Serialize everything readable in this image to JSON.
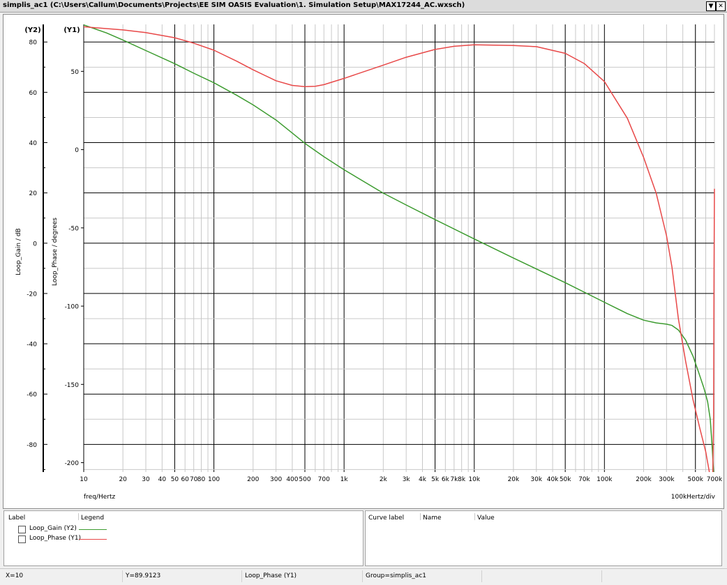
{
  "window": {
    "title": "simplis_ac1 (C:\\Users\\Callum\\Documents\\Projects\\EE SIM OASIS Evaluation\\1. Simulation Setup\\MAX17244_AC.wxsch)",
    "dropdown_glyph": "▼",
    "close_glyph": "✕"
  },
  "chart_data": {
    "type": "line",
    "x_scale": "log",
    "xlim": [
      10,
      700000
    ],
    "xlabel": "freq/Hertz",
    "x_div_label": "100kHertz/div",
    "x_ticks": [
      {
        "v": 10,
        "label": "10"
      },
      {
        "v": 20,
        "label": "20"
      },
      {
        "v": 30,
        "label": "30"
      },
      {
        "v": 40,
        "label": "40"
      },
      {
        "v": 50,
        "label": "50"
      },
      {
        "v": 60,
        "label": "60"
      },
      {
        "v": 70,
        "label": "70"
      },
      {
        "v": 80,
        "label": "80"
      },
      {
        "v": 100,
        "label": "100"
      },
      {
        "v": 200,
        "label": "200"
      },
      {
        "v": 300,
        "label": "300"
      },
      {
        "v": 400,
        "label": "400"
      },
      {
        "v": 500,
        "label": "500"
      },
      {
        "v": 700,
        "label": "700"
      },
      {
        "v": 1000,
        "label": "1k"
      },
      {
        "v": 2000,
        "label": "2k"
      },
      {
        "v": 3000,
        "label": "3k"
      },
      {
        "v": 4000,
        "label": "4k"
      },
      {
        "v": 5000,
        "label": "5k"
      },
      {
        "v": 6000,
        "label": "6k"
      },
      {
        "v": 7000,
        "label": "7k"
      },
      {
        "v": 8000,
        "label": "8k"
      },
      {
        "v": 10000,
        "label": "10k"
      },
      {
        "v": 20000,
        "label": "20k"
      },
      {
        "v": 30000,
        "label": "30k"
      },
      {
        "v": 40000,
        "label": "40k"
      },
      {
        "v": 50000,
        "label": "50k"
      },
      {
        "v": 70000,
        "label": "70k"
      },
      {
        "v": 100000,
        "label": "100k"
      },
      {
        "v": 200000,
        "label": "200k"
      },
      {
        "v": 300000,
        "label": "300k"
      },
      {
        "v": 500000,
        "label": "500k"
      },
      {
        "v": 700000,
        "label": "700k"
      }
    ],
    "y2_axis": {
      "tag": "(Y2)",
      "label": "Loop_Gain / dB",
      "ylim": [
        -91,
        87
      ],
      "ticks": [
        80,
        60,
        40,
        20,
        0,
        -20,
        -40,
        -60,
        -80
      ]
    },
    "y1_axis": {
      "tag": "(Y1)",
      "label": "Loop_Phase / degrees",
      "ylim": [
        -206,
        80
      ],
      "ticks": [
        50,
        0,
        -50,
        -100,
        -150,
        -200
      ]
    },
    "series": [
      {
        "name": "Loop_Gain",
        "legend": "Loop_Gain (Y2)",
        "axis": "y2",
        "color": "#3c9b2f",
        "points": [
          [
            10,
            86.8
          ],
          [
            15,
            83.6
          ],
          [
            20,
            80.8
          ],
          [
            30,
            76.6
          ],
          [
            50,
            71.4
          ],
          [
            70,
            67.6
          ],
          [
            100,
            63.8
          ],
          [
            150,
            58.8
          ],
          [
            200,
            55
          ],
          [
            300,
            49
          ],
          [
            400,
            43.8
          ],
          [
            500,
            39.7
          ],
          [
            700,
            34.4
          ],
          [
            1000,
            29.2
          ],
          [
            2000,
            19.9
          ],
          [
            3000,
            15.2
          ],
          [
            5000,
            9.4
          ],
          [
            10000,
            1.7
          ],
          [
            20000,
            -5.9
          ],
          [
            50000,
            -15.7
          ],
          [
            100000,
            -23.5
          ],
          [
            150000,
            -28
          ],
          [
            200000,
            -30.6
          ],
          [
            250000,
            -31.7
          ],
          [
            300000,
            -32.2
          ],
          [
            330000,
            -32.7
          ],
          [
            370000,
            -34.5
          ],
          [
            420000,
            -38.5
          ],
          [
            480000,
            -45
          ],
          [
            530000,
            -51.5
          ],
          [
            580000,
            -57.5
          ],
          [
            620000,
            -63
          ],
          [
            650000,
            -70
          ],
          [
            670000,
            -80
          ],
          [
            690000,
            -91
          ]
        ]
      },
      {
        "name": "Loop_Phase",
        "legend": "Loop_Phase (Y1)",
        "axis": "y1",
        "color": "#e84848",
        "points": [
          [
            10,
            78.5
          ],
          [
            20,
            76.5
          ],
          [
            30,
            74.8
          ],
          [
            50,
            71.5
          ],
          [
            70,
            68
          ],
          [
            100,
            63.5
          ],
          [
            150,
            56.5
          ],
          [
            200,
            51
          ],
          [
            300,
            44
          ],
          [
            400,
            41
          ],
          [
            500,
            40.2
          ],
          [
            600,
            40.5
          ],
          [
            700,
            41.5
          ],
          [
            1000,
            45.5
          ],
          [
            2000,
            54
          ],
          [
            3000,
            59
          ],
          [
            5000,
            64
          ],
          [
            7000,
            66
          ],
          [
            10000,
            67
          ],
          [
            20000,
            66.5
          ],
          [
            30000,
            65.8
          ],
          [
            50000,
            61.5
          ],
          [
            70000,
            55
          ],
          [
            100000,
            43.5
          ],
          [
            150000,
            20
          ],
          [
            200000,
            -5
          ],
          [
            250000,
            -28
          ],
          [
            300000,
            -55
          ],
          [
            330000,
            -75
          ],
          [
            370000,
            -108
          ],
          [
            420000,
            -135
          ],
          [
            480000,
            -160
          ],
          [
            540000,
            -178
          ],
          [
            600000,
            -193
          ],
          [
            640000,
            -206
          ]
        ]
      },
      {
        "name": "Loop_Phase_wrap",
        "axis": "y1",
        "color": "#e84848",
        "points": [
          [
            680000,
            -206
          ],
          [
            690000,
            -170
          ],
          [
            695000,
            -80
          ],
          [
            700000,
            -25
          ]
        ]
      }
    ]
  },
  "legend_panel": {
    "col_label": "Label",
    "col_legend": "Legend",
    "items": [
      {
        "name": "Loop_Gain (Y2)",
        "color": "#3c9b2f"
      },
      {
        "name": "Loop_Phase (Y1)",
        "color": "#e84848"
      }
    ]
  },
  "values_panel": {
    "col_curve_label": "Curve label",
    "col_name": "Name",
    "col_value": "Value"
  },
  "status": {
    "x": "X=10",
    "y": "Y=89.9123",
    "curve": "Loop_Phase (Y1)",
    "group": "Group=simplis_ac1"
  }
}
